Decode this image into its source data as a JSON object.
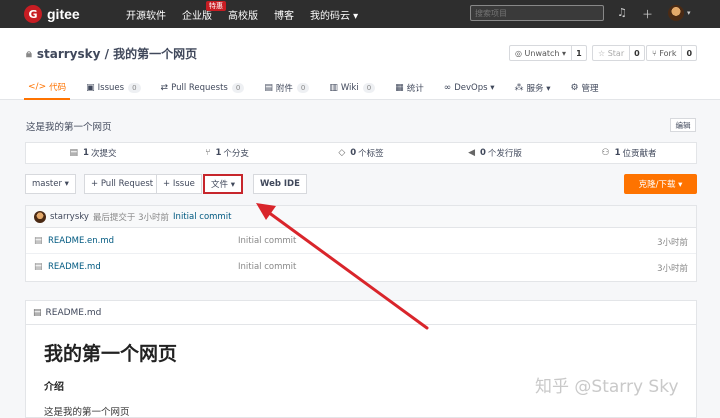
{
  "topbar": {
    "logo_letter": "G",
    "logo_text": "gitee",
    "nav": [
      "开源软件",
      "企业版",
      "高校版",
      "博客",
      "我的码云 ▾"
    ],
    "hot_badge": "特惠",
    "search_placeholder": "搜索项目",
    "bell_icon": "bell-icon",
    "plus_icon": "plus-icon"
  },
  "repo": {
    "title": "starrysky / 我的第一个网页",
    "watch_label": "◎ Unwatch ▾",
    "watch_count": "1",
    "star_label": "☆ Star",
    "star_count": "0",
    "fork_label": "⑂ Fork",
    "fork_count": "0"
  },
  "tabs": [
    {
      "icon": "</>",
      "label": "代码",
      "count": ""
    },
    {
      "icon": "▣",
      "label": "Issues",
      "count": "0"
    },
    {
      "icon": "⇄",
      "label": "Pull Requests",
      "count": "0"
    },
    {
      "icon": "▤",
      "label": "附件",
      "count": "0"
    },
    {
      "icon": "▥",
      "label": "Wiki",
      "count": "0"
    },
    {
      "icon": "▦",
      "label": "统计",
      "count": ""
    },
    {
      "icon": "∞",
      "label": "DevOps ▾",
      "count": ""
    },
    {
      "icon": "⁂",
      "label": "服务 ▾",
      "count": ""
    },
    {
      "icon": "⚙",
      "label": "管理",
      "count": ""
    }
  ],
  "description": "这是我的第一个网页",
  "edit_label": "编辑",
  "stats": [
    {
      "icon": "▤",
      "count": "1",
      "label": "次提交"
    },
    {
      "icon": "⑂",
      "count": "1",
      "label": "个分支"
    },
    {
      "icon": "◇",
      "count": "0",
      "label": "个标签"
    },
    {
      "icon": "◀",
      "count": "0",
      "label": "个发行版"
    },
    {
      "icon": "⚇",
      "count": "1",
      "label": "位贡献者"
    }
  ],
  "toolbar": {
    "branch": "master ▾",
    "pull_request": "+ Pull Request",
    "issue": "+ Issue",
    "file": "文件 ▾",
    "webide": "Web IDE",
    "clone": "克隆/下载 ▾"
  },
  "commit": {
    "author": "starrysky",
    "text": "最后提交于 3小时前",
    "message": "Initial commit"
  },
  "files": [
    {
      "name": "README.en.md",
      "message": "Initial commit",
      "time": "3小时前"
    },
    {
      "name": "README.md",
      "message": "Initial commit",
      "time": "3小时前"
    }
  ],
  "readme": {
    "filename": "README.md",
    "h1": "我的第一个网页",
    "h2": "介绍",
    "p": "这是我的第一个网页"
  },
  "watermark": "知乎 @Starry Sky",
  "colors": {
    "accent": "#fe7300",
    "brand": "#c71d23",
    "annotation": "#d9252b"
  }
}
